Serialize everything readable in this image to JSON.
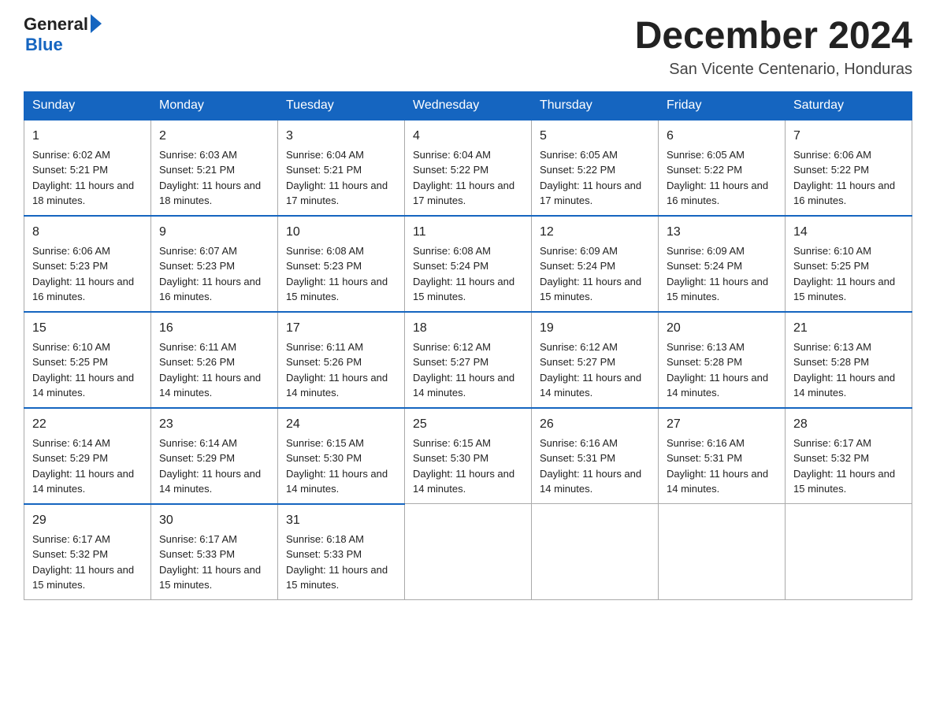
{
  "logo": {
    "general": "General",
    "blue": "Blue"
  },
  "header": {
    "month_title": "December 2024",
    "location": "San Vicente Centenario, Honduras"
  },
  "days_of_week": [
    "Sunday",
    "Monday",
    "Tuesday",
    "Wednesday",
    "Thursday",
    "Friday",
    "Saturday"
  ],
  "weeks": [
    [
      {
        "day": "1",
        "sunrise": "6:02 AM",
        "sunset": "5:21 PM",
        "daylight": "11 hours and 18 minutes."
      },
      {
        "day": "2",
        "sunrise": "6:03 AM",
        "sunset": "5:21 PM",
        "daylight": "11 hours and 18 minutes."
      },
      {
        "day": "3",
        "sunrise": "6:04 AM",
        "sunset": "5:21 PM",
        "daylight": "11 hours and 17 minutes."
      },
      {
        "day": "4",
        "sunrise": "6:04 AM",
        "sunset": "5:22 PM",
        "daylight": "11 hours and 17 minutes."
      },
      {
        "day": "5",
        "sunrise": "6:05 AM",
        "sunset": "5:22 PM",
        "daylight": "11 hours and 17 minutes."
      },
      {
        "day": "6",
        "sunrise": "6:05 AM",
        "sunset": "5:22 PM",
        "daylight": "11 hours and 16 minutes."
      },
      {
        "day": "7",
        "sunrise": "6:06 AM",
        "sunset": "5:22 PM",
        "daylight": "11 hours and 16 minutes."
      }
    ],
    [
      {
        "day": "8",
        "sunrise": "6:06 AM",
        "sunset": "5:23 PM",
        "daylight": "11 hours and 16 minutes."
      },
      {
        "day": "9",
        "sunrise": "6:07 AM",
        "sunset": "5:23 PM",
        "daylight": "11 hours and 16 minutes."
      },
      {
        "day": "10",
        "sunrise": "6:08 AM",
        "sunset": "5:23 PM",
        "daylight": "11 hours and 15 minutes."
      },
      {
        "day": "11",
        "sunrise": "6:08 AM",
        "sunset": "5:24 PM",
        "daylight": "11 hours and 15 minutes."
      },
      {
        "day": "12",
        "sunrise": "6:09 AM",
        "sunset": "5:24 PM",
        "daylight": "11 hours and 15 minutes."
      },
      {
        "day": "13",
        "sunrise": "6:09 AM",
        "sunset": "5:24 PM",
        "daylight": "11 hours and 15 minutes."
      },
      {
        "day": "14",
        "sunrise": "6:10 AM",
        "sunset": "5:25 PM",
        "daylight": "11 hours and 15 minutes."
      }
    ],
    [
      {
        "day": "15",
        "sunrise": "6:10 AM",
        "sunset": "5:25 PM",
        "daylight": "11 hours and 14 minutes."
      },
      {
        "day": "16",
        "sunrise": "6:11 AM",
        "sunset": "5:26 PM",
        "daylight": "11 hours and 14 minutes."
      },
      {
        "day": "17",
        "sunrise": "6:11 AM",
        "sunset": "5:26 PM",
        "daylight": "11 hours and 14 minutes."
      },
      {
        "day": "18",
        "sunrise": "6:12 AM",
        "sunset": "5:27 PM",
        "daylight": "11 hours and 14 minutes."
      },
      {
        "day": "19",
        "sunrise": "6:12 AM",
        "sunset": "5:27 PM",
        "daylight": "11 hours and 14 minutes."
      },
      {
        "day": "20",
        "sunrise": "6:13 AM",
        "sunset": "5:28 PM",
        "daylight": "11 hours and 14 minutes."
      },
      {
        "day": "21",
        "sunrise": "6:13 AM",
        "sunset": "5:28 PM",
        "daylight": "11 hours and 14 minutes."
      }
    ],
    [
      {
        "day": "22",
        "sunrise": "6:14 AM",
        "sunset": "5:29 PM",
        "daylight": "11 hours and 14 minutes."
      },
      {
        "day": "23",
        "sunrise": "6:14 AM",
        "sunset": "5:29 PM",
        "daylight": "11 hours and 14 minutes."
      },
      {
        "day": "24",
        "sunrise": "6:15 AM",
        "sunset": "5:30 PM",
        "daylight": "11 hours and 14 minutes."
      },
      {
        "day": "25",
        "sunrise": "6:15 AM",
        "sunset": "5:30 PM",
        "daylight": "11 hours and 14 minutes."
      },
      {
        "day": "26",
        "sunrise": "6:16 AM",
        "sunset": "5:31 PM",
        "daylight": "11 hours and 14 minutes."
      },
      {
        "day": "27",
        "sunrise": "6:16 AM",
        "sunset": "5:31 PM",
        "daylight": "11 hours and 14 minutes."
      },
      {
        "day": "28",
        "sunrise": "6:17 AM",
        "sunset": "5:32 PM",
        "daylight": "11 hours and 15 minutes."
      }
    ],
    [
      {
        "day": "29",
        "sunrise": "6:17 AM",
        "sunset": "5:32 PM",
        "daylight": "11 hours and 15 minutes."
      },
      {
        "day": "30",
        "sunrise": "6:17 AM",
        "sunset": "5:33 PM",
        "daylight": "11 hours and 15 minutes."
      },
      {
        "day": "31",
        "sunrise": "6:18 AM",
        "sunset": "5:33 PM",
        "daylight": "11 hours and 15 minutes."
      },
      null,
      null,
      null,
      null
    ]
  ],
  "labels": {
    "sunrise": "Sunrise:",
    "sunset": "Sunset:",
    "daylight": "Daylight:"
  },
  "colors": {
    "header_bg": "#1565c0",
    "header_text": "#ffffff",
    "border": "#aaaaaa",
    "row_border_top": "#1565c0"
  }
}
